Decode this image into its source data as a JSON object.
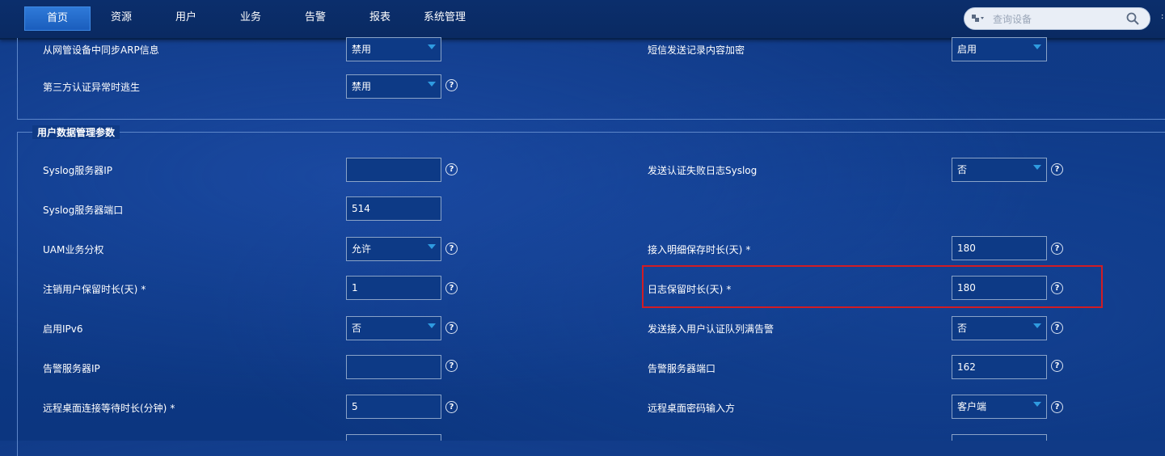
{
  "nav": {
    "items": [
      {
        "label": "首页",
        "active": true
      },
      {
        "label": "资源"
      },
      {
        "label": "用户"
      },
      {
        "label": "业务"
      },
      {
        "label": "告警"
      },
      {
        "label": "报表"
      },
      {
        "label": "系统管理"
      }
    ],
    "search_placeholder": "查询设备"
  },
  "top_section": {
    "rows": [
      {
        "left_label": "从网管设备中同步ARP信息",
        "left_value": "禁用",
        "right_label": "短信发送记录内容加密",
        "right_value": "启用"
      },
      {
        "left_label": "第三方认证异常时逃生",
        "left_value": "禁用"
      }
    ]
  },
  "section": {
    "title": "用户数据管理参数",
    "rows": [
      {
        "left_label": "Syslog服务器IP",
        "left_value": "",
        "right_label": "发送认证失败日志Syslog",
        "right_value": "否"
      },
      {
        "left_label": "Syslog服务器端口",
        "left_value": "514"
      },
      {
        "left_label": "UAM业务分权",
        "left_value": "允许",
        "right_label": "接入明细保存时长(天)",
        "right_required": "*",
        "right_value": "180"
      },
      {
        "left_label": "注销用户保留时长(天)",
        "left_required": "*",
        "left_value": "1",
        "right_label": "日志保留时长(天)",
        "right_required": "*",
        "right_value": "180"
      },
      {
        "left_label": "启用IPv6",
        "left_value": "否",
        "right_label": "发送接入用户认证队列满告警",
        "right_value": "否"
      },
      {
        "left_label": "告警服务器IP",
        "left_value": "",
        "right_label": "告警服务器端口",
        "right_value": "162"
      },
      {
        "left_label": "远程桌面连接等待时长(分钟)",
        "left_required": "*",
        "left_value": "5",
        "right_label": "远程桌面密码输入方",
        "right_value": "客户端"
      }
    ]
  },
  "colors": {
    "background": "#0f3a86",
    "nav_active": "#1f66c8",
    "select_arrow": "#2f9be0",
    "highlight_border": "#d11c24"
  },
  "icons": {
    "search": "magnifier-icon",
    "device_type": "device-type-dropdown-icon",
    "help": "question-circle-icon",
    "select": "triangle-down-icon"
  }
}
